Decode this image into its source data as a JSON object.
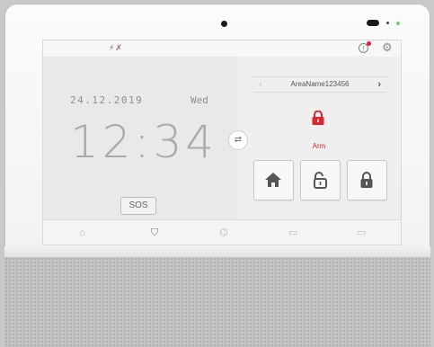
{
  "clock": {
    "date": "24.12.2019",
    "weekday": "Wed",
    "time": "12:34"
  },
  "sos_label": "SOS",
  "area": {
    "name": "AreaName123456",
    "prev": "‹",
    "next": "›"
  },
  "status": {
    "label": "Arm",
    "color": "#d9262a"
  },
  "colors": {
    "accent": "#d9262a",
    "notification_dot": "#e0203c",
    "led": "#6ad36a"
  },
  "status_bar_icons": [
    "wifi-off-icon",
    "network-off-icon"
  ],
  "mode_buttons": [
    "home-mode-icon",
    "disarm-unlock-icon",
    "arm-lock-icon"
  ],
  "nav_tabs": [
    "home-icon",
    "shield-icon",
    "devices-icon",
    "camera-icon",
    "camera-icon"
  ],
  "active_tab": "shield-icon"
}
